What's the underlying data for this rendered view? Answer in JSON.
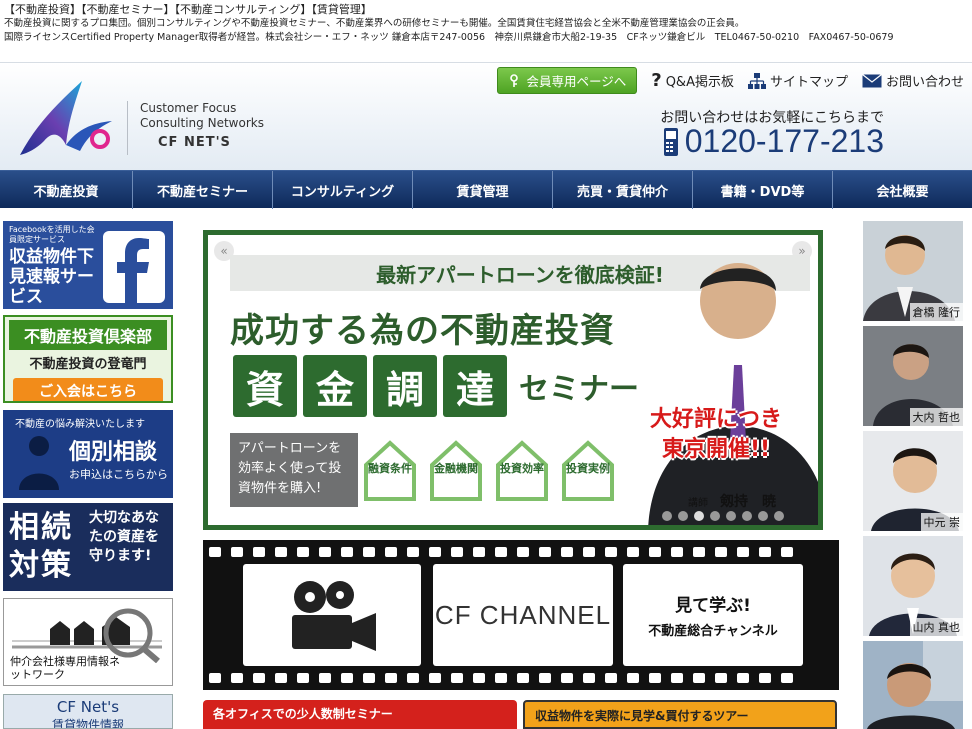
{
  "top_info": {
    "categories": "【不動産投資】【不動産セミナー】【不動産コンサルティング】【賃貸管理】",
    "line2": "不動産投資に関するプロ集団。個別コンサルティングや不動産投資セミナー、不動産業界への研修セミナーも開催。全国賃貸住宅経営協会と全米不動産管理業協会の正会員。",
    "line3": "国際ライセンスCertified Property Manager取得者が経営。株式会社シー・エフ・ネッツ 鎌倉本店〒247-0056　神奈川県鎌倉市大船2-19-35　CFネッツ鎌倉ビル　TEL0467-50-0210　FAX0467-50-0679"
  },
  "logo": {
    "line1": "Customer Focus",
    "line2": "Consulting Networks",
    "line3": "CF NET'S"
  },
  "topnav": {
    "member": "会員専用ページへ",
    "qa": "Q&A掲示板",
    "sitemap": "サイトマップ",
    "contact": "お問い合わせ"
  },
  "contact": {
    "note": "お問い合わせはお気軽にこちらまで",
    "phone": "0120-177-213"
  },
  "mainnav": [
    "不動産投資",
    "不動産セミナー",
    "コンサルティング",
    "賃貸管理",
    "売買・賃貸仲介",
    "書籍・DVD等",
    "会社概要"
  ],
  "left_banners": {
    "b1_small": "Facebookを活用した会員限定サービス",
    "b1_main": "収益物件下見速報サービス",
    "b2_title": "不動産投資倶楽部",
    "b2_sub": "不動産投資の登竜門",
    "b2_cta": "ご入会はこちら",
    "b3_top": "不動産の悩み解決いたします",
    "b3_main": "個別相談",
    "b3_sub": "お申込はこちらから",
    "b4_kanji": "相続対策",
    "b4_text": "大切なあなたの資産を守ります!",
    "b5_text": "仲介会社様専用情報ネットワーク",
    "b6_title": "CF Net's",
    "b6_sub": "賃貸物件情報"
  },
  "hero": {
    "strip": "最新アパートローンを徹底検証!",
    "title": "成功する為の不動産投資",
    "kanji": [
      "資",
      "金",
      "調",
      "達"
    ],
    "seminar": "セミナー",
    "leftbox": "アパートローンを効率よく使って投資物件を購入!",
    "houses": [
      "融資条件",
      "金融機関",
      "投資効率",
      "投資実例"
    ],
    "popular_l1": "大好評につき",
    "popular_l2": "東京開催!!",
    "lecturer_label": "講師",
    "lecturer_name": "剱持　暁",
    "prev_arrow": "«",
    "next_arrow": "»"
  },
  "film": {
    "channel": "CF CHANNEL",
    "slogan": "見て学ぶ!",
    "slogan_sub": "不動産総合チャンネル"
  },
  "promos": {
    "p1": "各オフィスでの少人数制セミナー",
    "p2": "収益物件を実際に見学&買付するツアー"
  },
  "lecturers": [
    "倉橋 隆行",
    "大内 哲也",
    "中元 崇",
    "山内 真也",
    ""
  ],
  "colors": {
    "nav_blue": "#0e2a5a",
    "brand_green": "#2d6b2f",
    "accent_red": "#d71a1a",
    "phone_blue": "#1b3c78"
  }
}
